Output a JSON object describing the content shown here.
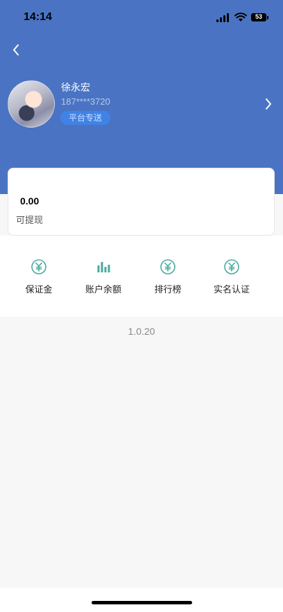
{
  "status_bar": {
    "time": "14:14",
    "battery": "53"
  },
  "profile": {
    "name": "徐永宏",
    "phone": "187****3720",
    "tag": "平台专送"
  },
  "balance": {
    "amount": "0.00",
    "label": "可提现"
  },
  "quick_menu": [
    {
      "label": "保证金",
      "icon": "yuan-circle-icon"
    },
    {
      "label": "账户余额",
      "icon": "bar-chart-icon"
    },
    {
      "label": "排行榜",
      "icon": "yuan-circle-icon"
    },
    {
      "label": "实名认证",
      "icon": "yuan-circle-icon"
    }
  ],
  "version": "1.0.20",
  "colors": {
    "header": "#4a74c3",
    "tag_bg": "#3f83e6",
    "icon_teal": "#4aa9a0"
  }
}
